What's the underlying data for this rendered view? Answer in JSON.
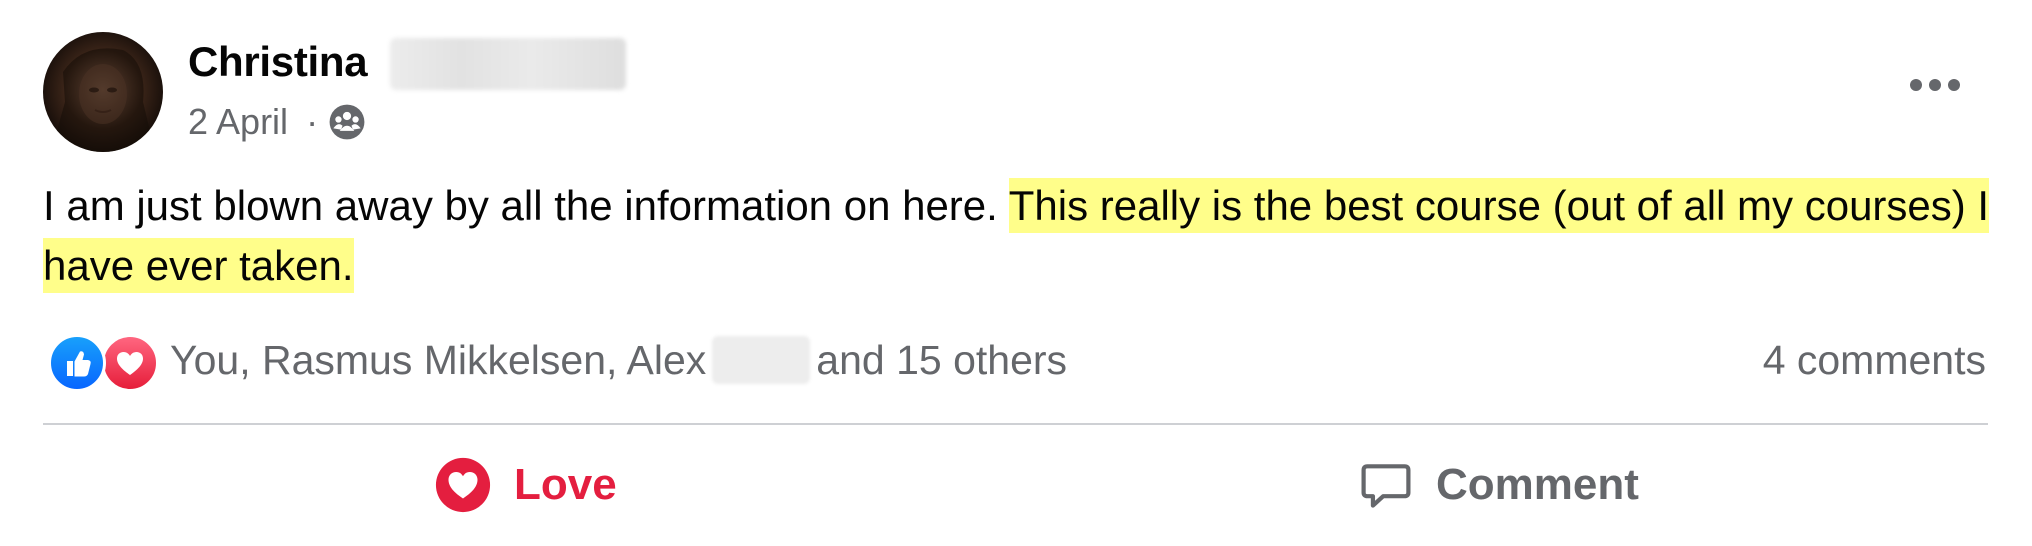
{
  "post": {
    "author": {
      "name": "Christina",
      "avatar_icon": "profile-photo"
    },
    "meta": {
      "date": "2 April",
      "separator": "·",
      "audience_icon": "group-icon"
    },
    "more_icon": "more-horizontal-icon",
    "text": {
      "plain": "I am just blown away by all the information on here. ",
      "highlighted": "This really is the best course (out of all my courses) I have ever taken."
    },
    "highlight_color": "#fffe8a"
  },
  "reactions": {
    "icons": [
      "like-reaction-icon",
      "love-reaction-icon"
    ],
    "names_before": "You, Rasmus Mikkelsen, Alex",
    "names_after": "and 15 others",
    "comment_count": "4 comments"
  },
  "actions": {
    "love_label": "Love",
    "love_color": "#e41e3f",
    "comment_label": "Comment"
  }
}
